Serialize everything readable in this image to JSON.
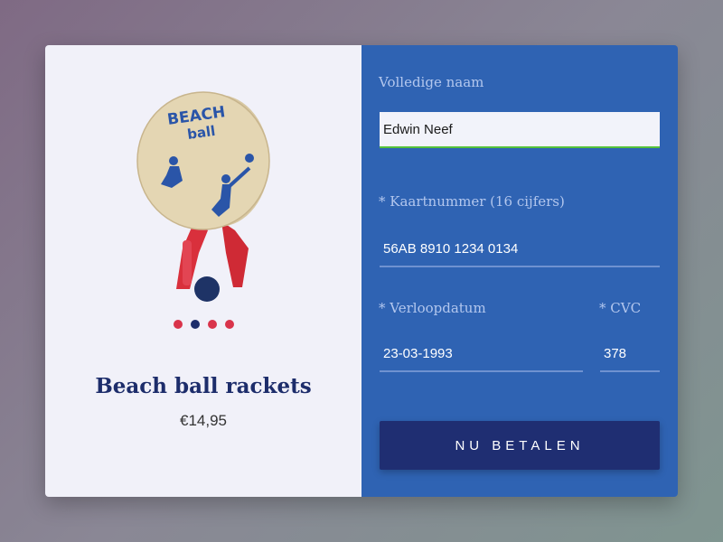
{
  "product": {
    "name": "Beach ball rackets",
    "price": "€14,95",
    "image": {
      "brand_text_line1": "BEACH",
      "brand_text_line2": "ball",
      "icon": "beach-rackets-image"
    },
    "carousel": {
      "dots": [
        {
          "color": "#d9344b"
        },
        {
          "color": "#1d2d6b"
        },
        {
          "color": "#d9344b"
        },
        {
          "color": "#d9344b"
        }
      ],
      "active_index": 1
    }
  },
  "form": {
    "name": {
      "label": "Volledige naam",
      "value": "Edwin Neef"
    },
    "card": {
      "label": "* Kaartnummer (16 cijfers)",
      "value": "56AB 8910 1234 0134"
    },
    "expiry": {
      "label": "* Verloopdatum",
      "value": "23-03-1993"
    },
    "cvc": {
      "label": "* CVC",
      "value": "378"
    },
    "submit_label": "NU BETALEN"
  },
  "colors": {
    "panel_blue": "#2f63b3",
    "button_navy": "#1f2e72",
    "accent_red": "#d9344b",
    "focus_green": "#54c23a"
  }
}
